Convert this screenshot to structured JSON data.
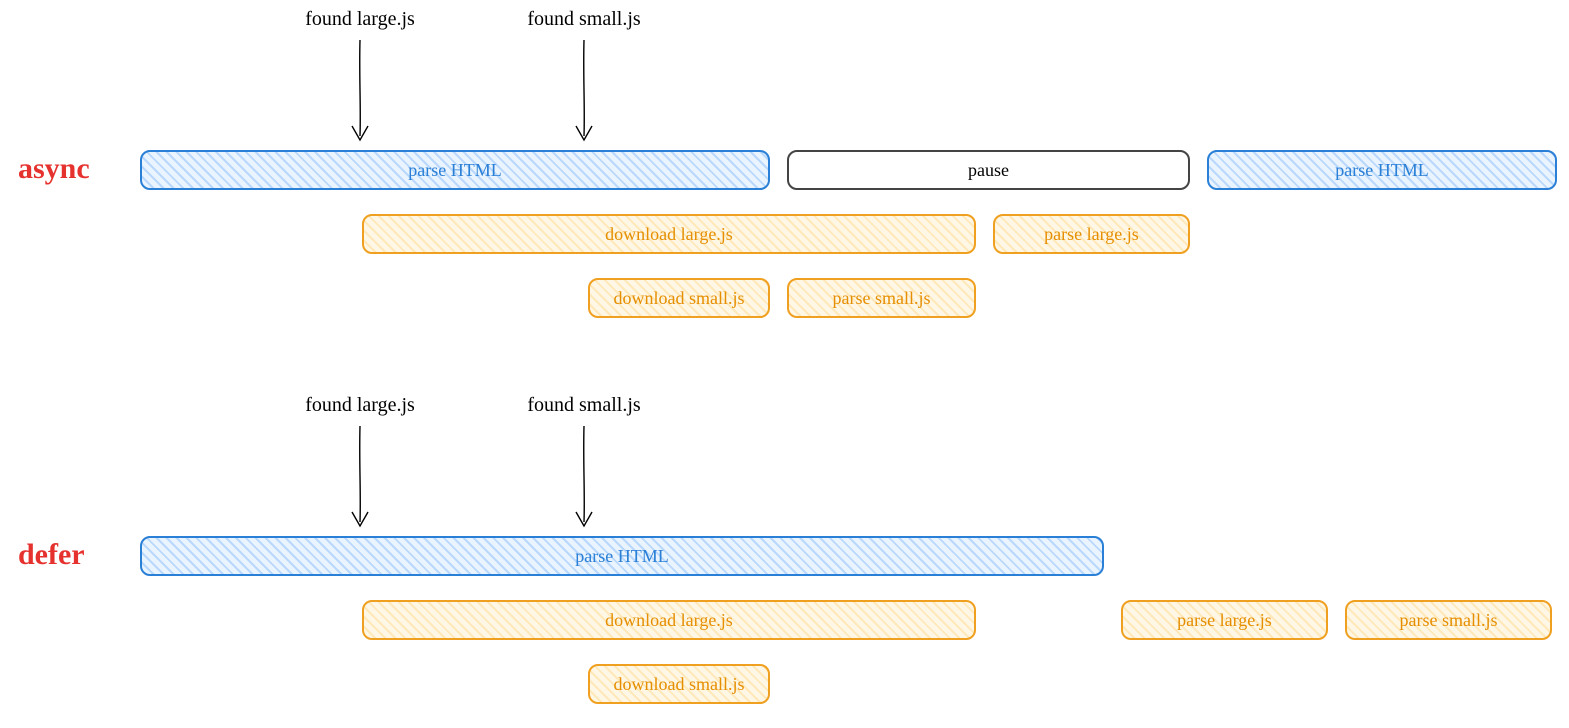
{
  "async": {
    "label": "async",
    "annotations": {
      "found_large": "found large.js",
      "found_small": "found small.js"
    },
    "row1": {
      "parse1": "parse HTML",
      "pause": "pause",
      "parse2": "parse HTML"
    },
    "row2": {
      "download_large": "download large.js",
      "parse_large": "parse large.js"
    },
    "row3": {
      "download_small": "download small.js",
      "parse_small": "parse small.js"
    }
  },
  "defer": {
    "label": "defer",
    "annotations": {
      "found_large": "found large.js",
      "found_small": "found small.js"
    },
    "row1": {
      "parse1": "parse HTML"
    },
    "row2": {
      "download_large": "download large.js",
      "parse_large": "parse large.js",
      "parse_small": "parse small.js"
    },
    "row3": {
      "download_small": "download small.js"
    }
  },
  "chart_data": {
    "type": "timeline",
    "description": "Comparison of script loading strategies async vs defer on a horizontal time axis",
    "rows": [
      {
        "group": "async",
        "lane": "annotations",
        "events": [
          {
            "label": "found large.js",
            "time": 360
          },
          {
            "label": "found small.js",
            "time": 584
          }
        ]
      },
      {
        "group": "async",
        "lane": "html",
        "bars": [
          {
            "label": "parse HTML",
            "start": 140,
            "end": 770,
            "style": "blue"
          },
          {
            "label": "pause",
            "start": 787,
            "end": 1190,
            "style": "white"
          },
          {
            "label": "parse HTML",
            "start": 1207,
            "end": 1557,
            "style": "blue"
          }
        ]
      },
      {
        "group": "async",
        "lane": "large.js",
        "bars": [
          {
            "label": "download large.js",
            "start": 362,
            "end": 976,
            "style": "orange"
          },
          {
            "label": "parse large.js",
            "start": 993,
            "end": 1190,
            "style": "orange"
          }
        ]
      },
      {
        "group": "async",
        "lane": "small.js",
        "bars": [
          {
            "label": "download small.js",
            "start": 588,
            "end": 770,
            "style": "orange"
          },
          {
            "label": "parse small.js",
            "start": 787,
            "end": 976,
            "style": "orange"
          }
        ]
      },
      {
        "group": "defer",
        "lane": "annotations",
        "events": [
          {
            "label": "found large.js",
            "time": 360
          },
          {
            "label": "found small.js",
            "time": 584
          }
        ]
      },
      {
        "group": "defer",
        "lane": "html",
        "bars": [
          {
            "label": "parse HTML",
            "start": 140,
            "end": 1104,
            "style": "blue"
          }
        ]
      },
      {
        "group": "defer",
        "lane": "large.js / parse",
        "bars": [
          {
            "label": "download large.js",
            "start": 362,
            "end": 976,
            "style": "orange"
          },
          {
            "label": "parse large.js",
            "start": 1121,
            "end": 1328,
            "style": "orange"
          },
          {
            "label": "parse small.js",
            "start": 1345,
            "end": 1552,
            "style": "orange"
          }
        ]
      },
      {
        "group": "defer",
        "lane": "small.js",
        "bars": [
          {
            "label": "download small.js",
            "start": 588,
            "end": 770,
            "style": "orange"
          }
        ]
      }
    ]
  }
}
